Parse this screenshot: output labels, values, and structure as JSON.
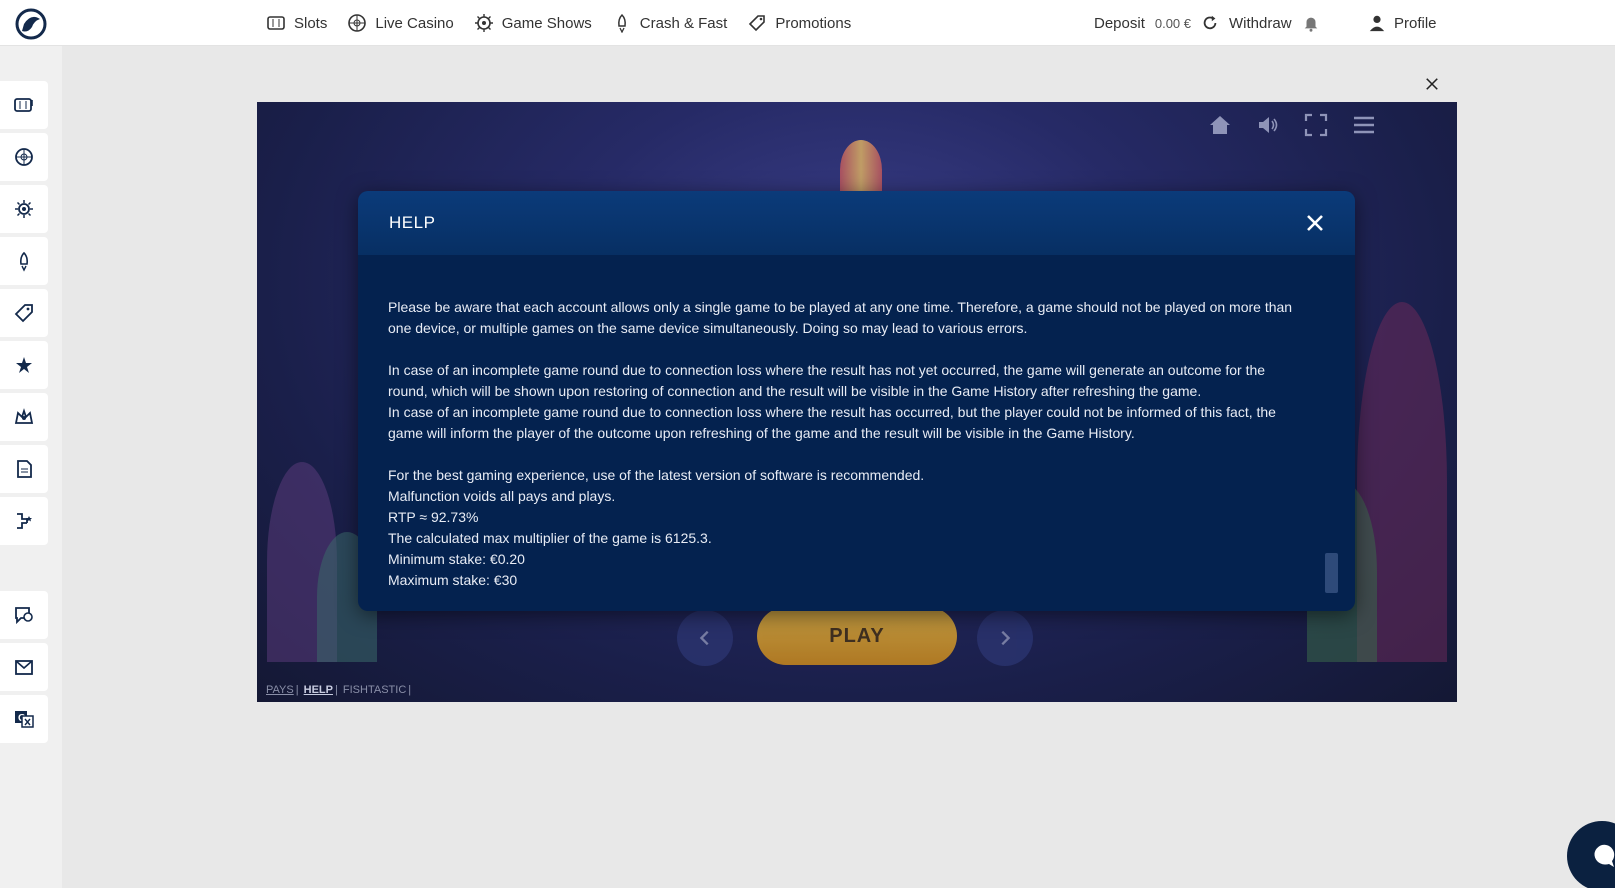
{
  "nav": {
    "items": [
      {
        "label": "Slots",
        "icon": "slot-machine-icon"
      },
      {
        "label": "Live Casino",
        "icon": "roulette-icon"
      },
      {
        "label": "Game Shows",
        "icon": "wheel-icon"
      },
      {
        "label": "Crash & Fast",
        "icon": "rocket-icon"
      },
      {
        "label": "Promotions",
        "icon": "ticket-icon"
      }
    ]
  },
  "account": {
    "deposit_label": "Deposit",
    "balance": "0.00 €",
    "withdraw_label": "Withdraw",
    "profile_label": "Profile"
  },
  "sidebar": {
    "items": [
      "slot-machine-icon",
      "roulette-icon",
      "wheel-icon",
      "rocket-icon",
      "ticket-icon",
      "star-badge-icon",
      "crown-icon",
      "document-icon",
      "tournament-icon",
      "support-chat-icon",
      "mail-icon",
      "translate-icon"
    ]
  },
  "game": {
    "play_label": "PLAY",
    "footer": {
      "pays": "PAYS",
      "help": "HELP",
      "name": "FISHTASTIC"
    }
  },
  "help": {
    "title": "HELP",
    "paragraphs": [
      "Please be aware that each account allows only a single game to be played at any one time. Therefore, a game should not be played on more than one device, or multiple games on the same device simultaneously. Doing so may lead to various errors.",
      "In case of an incomplete game round due to connection loss where the result has not yet occurred, the game will generate an outcome for the round, which will be shown upon restoring of connection and the result will be visible in the Game History after refreshing the game.",
      "In case of an incomplete game round due to connection loss where the result has occurred, but the player could not be informed of this fact, the game will inform the player of the outcome upon refreshing of the game and the result will be visible in the Game History.",
      "For the best gaming experience, use of the latest version of software is recommended.",
      "Malfunction voids all pays and plays.",
      "RTP ≈ 92.73%",
      "The calculated max multiplier of the game is 6125.3.",
      "Minimum stake: €0.20",
      "Maximum stake: €30"
    ]
  },
  "colors": {
    "modal_bg": "#04224f",
    "modal_header": "#0b3b7a",
    "play": "#f6c23b"
  }
}
